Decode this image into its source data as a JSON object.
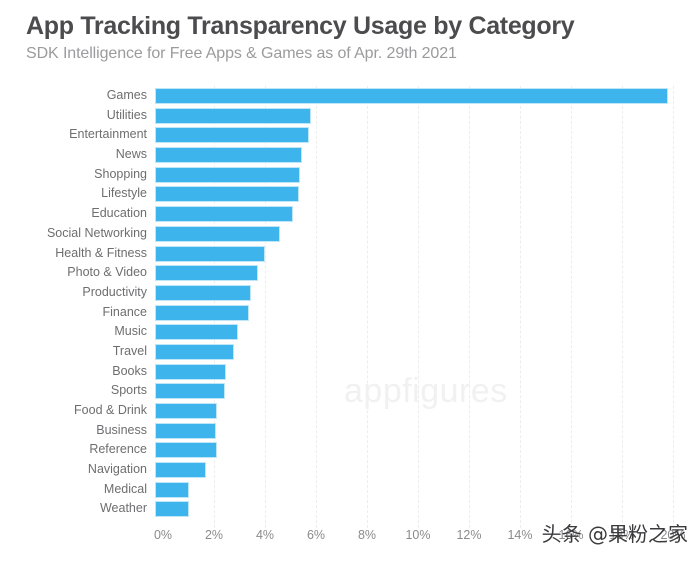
{
  "header": {
    "title": "App Tracking Transparency Usage by Category",
    "subtitle": "SDK Intelligence for Free Apps & Games as of Apr. 29th 2021",
    "title_color": "#4c4c4e",
    "subtitle_color": "#9b9b9d"
  },
  "watermarks": {
    "center": "appfigures",
    "corner": "头条 @果粉之家"
  },
  "axis": {
    "tick_labels": [
      "0%",
      "2%",
      "4%",
      "6%",
      "8%",
      "10%",
      "12%",
      "14%",
      "16%",
      "18%",
      "20%"
    ],
    "tick_values": [
      0,
      2,
      4,
      6,
      8,
      10,
      12,
      14,
      16,
      18,
      20
    ]
  },
  "style": {
    "bar_color": "#3db5ec",
    "bar_border_color": "#bfe6f7",
    "gridline_color": "#ededee",
    "label_color": "#6e6e70",
    "tick_color": "#8b8b8d"
  },
  "chart_data": {
    "type": "bar",
    "orientation": "horizontal",
    "title": "App Tracking Transparency Usage by Category",
    "subtitle": "SDK Intelligence for Free Apps & Games as of Apr. 29th 2021",
    "xlabel": "",
    "ylabel": "",
    "xlim": [
      0,
      20
    ],
    "xunit": "%",
    "grid": true,
    "grid_axis": "x",
    "legend": false,
    "categories": [
      "Games",
      "Utilities",
      "Entertainment",
      "News",
      "Shopping",
      "Lifestyle",
      "Education",
      "Social Networking",
      "Health & Fitness",
      "Photo & Video",
      "Productivity",
      "Finance",
      "Music",
      "Travel",
      "Books",
      "Sports",
      "Food & Drink",
      "Business",
      "Reference",
      "Navigation",
      "Medical",
      "Weather"
    ],
    "values": [
      20.1,
      6.1,
      6.05,
      5.75,
      5.7,
      5.65,
      5.4,
      4.9,
      4.3,
      4.05,
      3.75,
      3.7,
      3.25,
      3.1,
      2.8,
      2.75,
      2.45,
      2.4,
      2.45,
      2.0,
      1.35,
      1.35
    ]
  }
}
